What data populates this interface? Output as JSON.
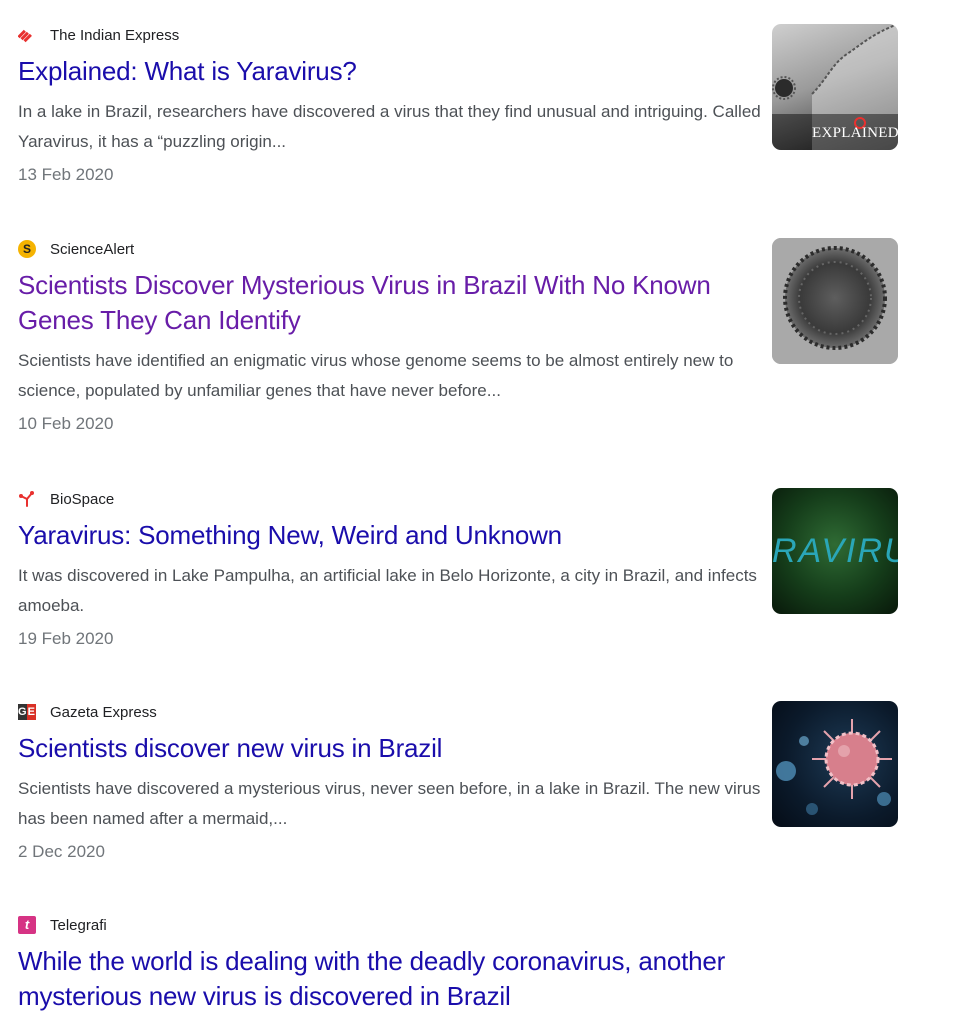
{
  "results": [
    {
      "source": "The Indian Express",
      "title": "Explained: What is Yaravirus?",
      "snippet": "In a lake in Brazil, researchers have discovered a virus that they find unusual and intriguing. Called Yaravirus, it has a “puzzling origin...",
      "date": "13 Feb 2020",
      "thumb_text": "EXPLAINED",
      "visited": false
    },
    {
      "source": "ScienceAlert",
      "title": "Scientists Discover Mysterious Virus in Brazil With No Known Genes They Can Identify",
      "snippet": "Scientists have identified an enigmatic virus whose genome seems to be almost entirely new to science, populated by unfamiliar genes that have never before...",
      "date": "10 Feb 2020",
      "visited": true
    },
    {
      "source": "BioSpace",
      "title": "Yaravirus: Something New, Weird and Unknown",
      "snippet": "It was discovered in Lake Pampulha, an artificial lake in Belo Horizonte, a city in Brazil, and infects amoeba.",
      "date": "19 Feb 2020",
      "thumb_text": "RAVIRU",
      "visited": false
    },
    {
      "source": "Gazeta Express",
      "title": "Scientists discover new virus in Brazil",
      "snippet": "Scientists have discovered a mysterious virus, never seen before, in a lake in Brazil. The new virus has been named after a mermaid,...",
      "date": "2 Dec 2020",
      "visited": false
    },
    {
      "source": "Telegrafi",
      "title": "While the world is dealing with the deadly coronavirus, another mysterious new virus is discovered in Brazil",
      "visited": false
    }
  ],
  "colors": {
    "link": "#1a0dab",
    "visited": "#681da8",
    "snippet": "#4d5156",
    "date": "#70757a"
  },
  "icons": [
    "indian-express-favicon",
    "sciencealert-favicon",
    "biospace-favicon",
    "gazeta-express-favicon",
    "telegrafi-favicon"
  ]
}
